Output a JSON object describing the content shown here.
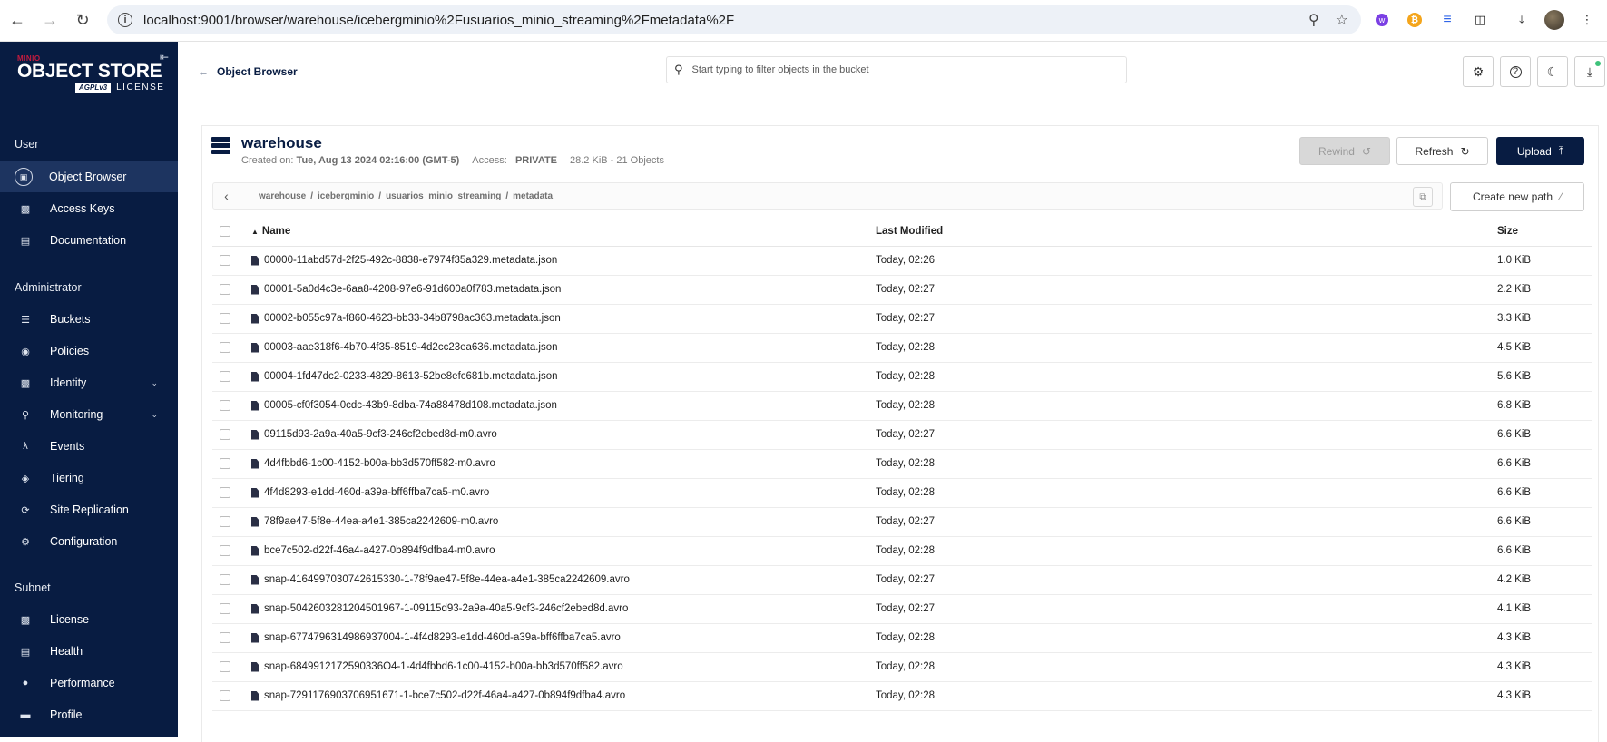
{
  "browser": {
    "url": "localhost:9001/browser/warehouse/icebergminio%2Fusuarios_minio_streaming%2Fmetadata%2F"
  },
  "sidebar": {
    "logo": {
      "brand": "MINIO",
      "product": "OBJECT STORE",
      "agpl": "AGPLv3",
      "license": "LICENSE"
    },
    "sections": [
      {
        "label": "User",
        "items": [
          {
            "label": "Object Browser",
            "icon": "object-browser-icon",
            "active": true
          },
          {
            "label": "Access Keys",
            "icon": "access-keys-icon"
          },
          {
            "label": "Documentation",
            "icon": "documentation-icon"
          }
        ]
      },
      {
        "label": "Administrator",
        "items": [
          {
            "label": "Buckets",
            "icon": "buckets-icon"
          },
          {
            "label": "Policies",
            "icon": "policies-icon"
          },
          {
            "label": "Identity",
            "icon": "identity-icon",
            "expandable": true
          },
          {
            "label": "Monitoring",
            "icon": "monitoring-icon",
            "expandable": true
          },
          {
            "label": "Events",
            "icon": "lambda-icon"
          },
          {
            "label": "Tiering",
            "icon": "tiering-icon"
          },
          {
            "label": "Site Replication",
            "icon": "replication-icon"
          },
          {
            "label": "Configuration",
            "icon": "gear-icon"
          }
        ]
      },
      {
        "label": "Subnet",
        "items": [
          {
            "label": "License",
            "icon": "license-icon"
          },
          {
            "label": "Health",
            "icon": "health-icon"
          },
          {
            "label": "Performance",
            "icon": "performance-icon"
          },
          {
            "label": "Profile",
            "icon": "profile-icon"
          }
        ]
      }
    ]
  },
  "topbar": {
    "back_label": "Object Browser",
    "search_placeholder": "Start typing to filter objects in the bucket"
  },
  "bucket": {
    "name": "warehouse",
    "created_label": "Created on:",
    "created_value": "Tue, Aug 13 2024 02:16:00 (GMT-5)",
    "access_label": "Access:",
    "access_value": "PRIVATE",
    "usage": "28.2 KiB - 21 Objects",
    "rewind_label": "Rewind",
    "refresh_label": "Refresh",
    "upload_label": "Upload",
    "new_path_label": "Create new path"
  },
  "breadcrumbs": [
    "warehouse",
    "icebergminio",
    "usuarios_minio_streaming",
    "metadata"
  ],
  "table": {
    "headers": {
      "name": "Name",
      "modified": "Last Modified",
      "size": "Size"
    },
    "rows": [
      {
        "name": "00000-11abd57d-2f25-492c-8838-e7974f35a329.metadata.json",
        "modified": "Today, 02:26",
        "size": "1.0 KiB"
      },
      {
        "name": "00001-5a0d4c3e-6aa8-4208-97e6-91d600a0f783.metadata.json",
        "modified": "Today, 02:27",
        "size": "2.2 KiB"
      },
      {
        "name": "00002-b055c97a-f860-4623-bb33-34b8798ac363.metadata.json",
        "modified": "Today, 02:27",
        "size": "3.3 KiB"
      },
      {
        "name": "00003-aae318f6-4b70-4f35-8519-4d2cc23ea636.metadata.json",
        "modified": "Today, 02:28",
        "size": "4.5 KiB"
      },
      {
        "name": "00004-1fd47dc2-0233-4829-8613-52be8efc681b.metadata.json",
        "modified": "Today, 02:28",
        "size": "5.6 KiB"
      },
      {
        "name": "00005-cf0f3054-0cdc-43b9-8dba-74a88478d108.metadata.json",
        "modified": "Today, 02:28",
        "size": "6.8 KiB"
      },
      {
        "name": "09115d93-2a9a-40a5-9cf3-246cf2ebed8d-m0.avro",
        "modified": "Today, 02:27",
        "size": "6.6 KiB"
      },
      {
        "name": "4d4fbbd6-1c00-4152-b00a-bb3d570ff582-m0.avro",
        "modified": "Today, 02:28",
        "size": "6.6 KiB"
      },
      {
        "name": "4f4d8293-e1dd-460d-a39a-bff6ffba7ca5-m0.avro",
        "modified": "Today, 02:28",
        "size": "6.6 KiB"
      },
      {
        "name": "78f9ae47-5f8e-44ea-a4e1-385ca2242609-m0.avro",
        "modified": "Today, 02:27",
        "size": "6.6 KiB"
      },
      {
        "name": "bce7c502-d22f-46a4-a427-0b894f9dfba4-m0.avro",
        "modified": "Today, 02:28",
        "size": "6.6 KiB"
      },
      {
        "name": "snap-4164997030742615330-1-78f9ae47-5f8e-44ea-a4e1-385ca2242609.avro",
        "modified": "Today, 02:27",
        "size": "4.2 KiB"
      },
      {
        "name": "snap-5042603281204501967-1-09115d93-2a9a-40a5-9cf3-246cf2ebed8d.avro",
        "modified": "Today, 02:27",
        "size": "4.1 KiB"
      },
      {
        "name": "snap-6774796314986937004-1-4f4d8293-e1dd-460d-a39a-bff6ffba7ca5.avro",
        "modified": "Today, 02:28",
        "size": "4.3 KiB"
      },
      {
        "name": "snap-6849912172590336O4-1-4d4fbbd6-1c00-4152-b00a-bb3d570ff582.avro",
        "modified": "Today, 02:28",
        "size": "4.3 KiB"
      },
      {
        "name": "snap-7291176903706951671-1-bce7c502-d22f-46a4-a427-0b894f9dfba4.avro",
        "modified": "Today, 02:28",
        "size": "4.3 KiB"
      }
    ]
  }
}
